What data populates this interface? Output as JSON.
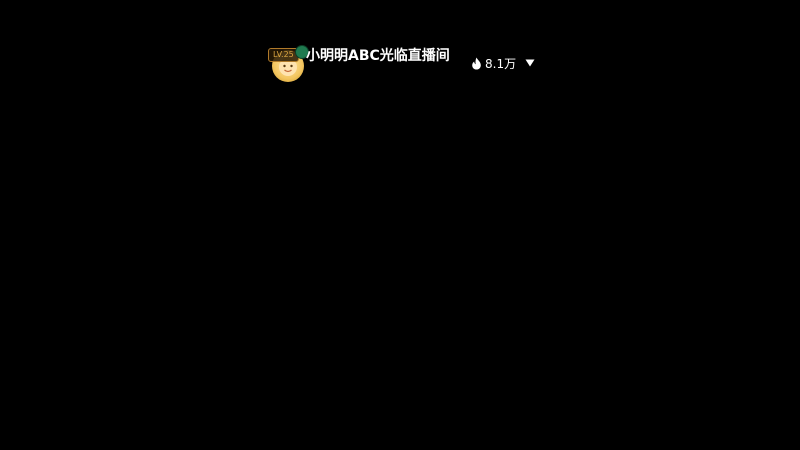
{
  "stream": {
    "room_title": "小明明ABC光临直播间",
    "level_badge": "LV.25",
    "heat_value": "8.1万",
    "icons": {
      "avatar": "streamer-avatar",
      "small_badge": "fan-badge-icon",
      "heat": "flame-icon",
      "dropdown": "caret-down-icon"
    },
    "colors": {
      "background": "#000000",
      "text": "#ffffff",
      "level_badge": "#d9a441"
    }
  }
}
